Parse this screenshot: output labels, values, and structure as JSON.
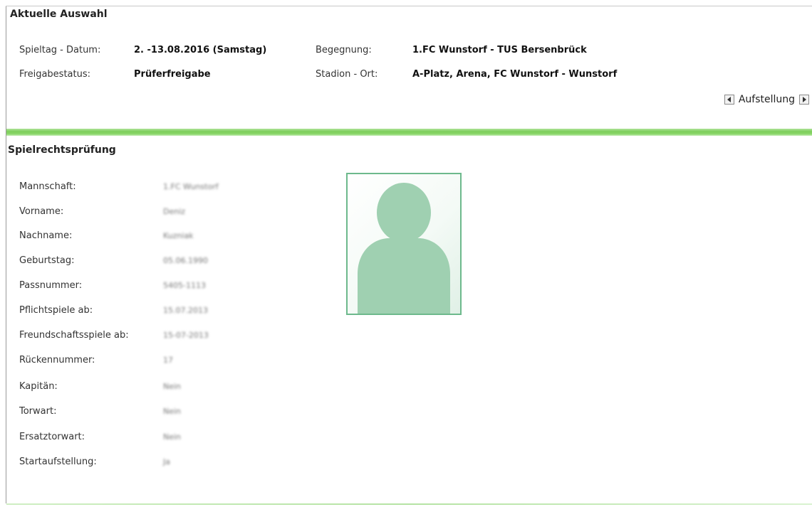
{
  "current_selection": {
    "title": "Aktuelle Auswahl",
    "matchday_label": "Spieltag - Datum:",
    "matchday_value": "2. -13.08.2016 (Samstag)",
    "fixture_label": "Begegnung:",
    "fixture_value": "1.FC Wunstorf - TUS Bersenbrück",
    "release_label": "Freigabestatus:",
    "release_value": "Prüferfreigabe",
    "stadium_label": "Stadion - Ort:",
    "stadium_value": "A-Platz, Arena, FC Wunstorf - Wunstorf"
  },
  "navigation": {
    "label": "Aufstellung",
    "prev_icon": "triangle-left-icon",
    "next_icon": "triangle-right-icon"
  },
  "eligibility": {
    "title": "Spielrechtsprüfung",
    "fields": [
      {
        "label": "Mannschaft:",
        "value": "1.FC Wunstorf"
      },
      {
        "label": "Vorname:",
        "value": "Deniz"
      },
      {
        "label": "Nachname:",
        "value": "Kuzniak"
      },
      {
        "label": "Geburtstag:",
        "value": "05.06.1990"
      },
      {
        "label": "Passnummer:",
        "value": "5405-1113"
      },
      {
        "label": "Pflichtspiele ab:",
        "value": "15.07.2013"
      },
      {
        "label": "Freundschaftsspiele ab:",
        "value": "15-07-2013"
      },
      {
        "label": "Rückennummer:",
        "value": "17"
      },
      {
        "label": "Kapitän:",
        "value": "Nein"
      },
      {
        "label": "Torwart:",
        "value": "Nein"
      },
      {
        "label": "Ersatztorwart:",
        "value": "Nein"
      },
      {
        "label": "Startaufstellung:",
        "value": "Ja"
      }
    ],
    "photo_icon": "player-silhouette-icon"
  },
  "colors": {
    "accent_green": "#7dcf5a",
    "photo_border": "#6db98c",
    "silhouette": "#9fd0b1"
  }
}
